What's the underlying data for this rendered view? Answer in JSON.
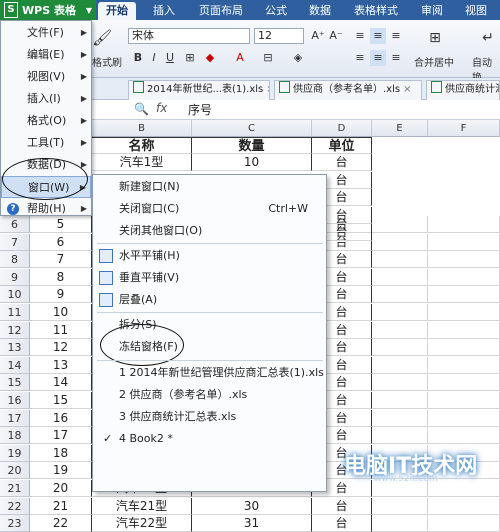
{
  "app": {
    "logo": "S",
    "name": "WPS 表格"
  },
  "ribbon_tabs": [
    "开始",
    "插入",
    "页面布局",
    "公式",
    "数据",
    "表格样式",
    "审阅",
    "视图"
  ],
  "ribbon": {
    "font_name": "宋体",
    "font_size": "12",
    "format_painter": "格式刷",
    "merge_center": "合并居中",
    "wrap": "自动换"
  },
  "doc_tabs": [
    "2014年新世纪...表(1).xls",
    "供应商（参考名单）.xls",
    "供应商统计汇总表.xls"
  ],
  "formula_bar": {
    "fx": "fx",
    "content": "序号"
  },
  "columns": [
    "B",
    "C",
    "D",
    "E",
    "F"
  ],
  "header_row": {
    "b": "名称",
    "c": "数量",
    "d": "单位"
  },
  "rows": [
    {
      "n": "6",
      "a": "5",
      "d": "台"
    },
    {
      "n": "7",
      "a": "6",
      "d": "台"
    },
    {
      "n": "8",
      "a": "7",
      "d": "台"
    },
    {
      "n": "9",
      "a": "8",
      "d": "台"
    },
    {
      "n": "10",
      "a": "9",
      "d": "台"
    },
    {
      "n": "11",
      "a": "10",
      "d": "台"
    },
    {
      "n": "12",
      "a": "11",
      "d": "台"
    },
    {
      "n": "13",
      "a": "12",
      "d": "台"
    },
    {
      "n": "14",
      "a": "13",
      "d": "台"
    },
    {
      "n": "15",
      "a": "14",
      "d": "台"
    },
    {
      "n": "16",
      "a": "15",
      "d": "台"
    },
    {
      "n": "17",
      "a": "16",
      "d": "台"
    },
    {
      "n": "18",
      "a": "17",
      "d": "台"
    },
    {
      "n": "19",
      "a": "18",
      "d": "台"
    },
    {
      "n": "20",
      "a": "19",
      "d": "台"
    },
    {
      "n": "21",
      "a": "20",
      "b": "汽车20型",
      "c": "29",
      "d": "台"
    },
    {
      "n": "22",
      "a": "21",
      "b": "汽车21型",
      "c": "30",
      "d": "台"
    },
    {
      "n": "23",
      "a": "22",
      "b": "汽车22型",
      "c": "31",
      "d": "台"
    }
  ],
  "visible_top_row": {
    "b": "汽车1型",
    "c": "10",
    "d": "台"
  },
  "main_menu": [
    {
      "label": "文件(F)",
      "sub": true
    },
    {
      "label": "编辑(E)",
      "sub": true
    },
    {
      "label": "视图(V)",
      "sub": true
    },
    {
      "label": "插入(I)",
      "sub": true
    },
    {
      "label": "格式(O)",
      "sub": true
    },
    {
      "label": "工具(T)",
      "sub": true
    },
    {
      "label": "数据(D)",
      "sub": true
    },
    {
      "label": "窗口(W)",
      "sub": true
    },
    {
      "label": "帮助(H)",
      "sub": true
    }
  ],
  "window_menu": {
    "new_window": "新建窗口(N)",
    "close_window": "关闭窗口(C)",
    "close_shortcut": "Ctrl+W",
    "close_others": "关闭其他窗口(O)",
    "tile_h": "水平平铺(H)",
    "tile_v": "垂直平铺(V)",
    "cascade": "层叠(A)",
    "split": "拆分(S)",
    "freeze": "冻结窗格(F)",
    "files": [
      "1 2014年新世纪管理供应商汇总表(1).xls",
      "2 供应商（参考名单）.xls",
      "3 供应商统计汇总表.xls",
      "4 Book2 *"
    ],
    "check": "✓"
  },
  "watermark": {
    "text": "电脑IT技术网",
    "url": "www.52it.com"
  }
}
